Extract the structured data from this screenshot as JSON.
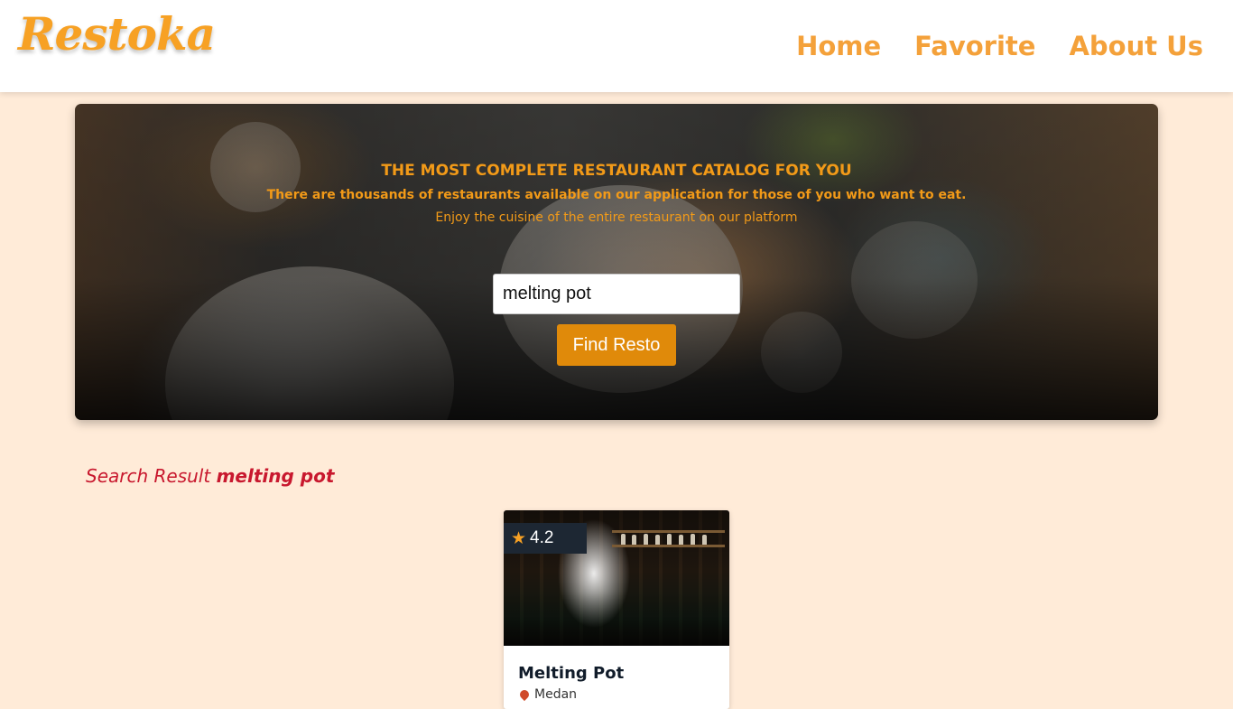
{
  "header": {
    "logo": "Restoka",
    "nav": [
      "Home",
      "Favorite",
      "About Us"
    ]
  },
  "hero": {
    "title": "THE MOST COMPLETE RESTAURANT CATALOG FOR YOU",
    "subtitle": "There are thousands of restaurants available on our application for those of you who want to eat.",
    "tagline": "Enjoy the cuisine of the entire restaurant on our platform"
  },
  "search": {
    "value": "melting pot",
    "button_label": "Find Resto"
  },
  "result": {
    "prefix": "Search Result",
    "query": "melting pot"
  },
  "restaurants": [
    {
      "name": "Melting Pot",
      "rating": "4.2",
      "city": "Medan"
    }
  ],
  "colors": {
    "background": "#ffebd8",
    "accent": "#f4a13a",
    "button": "#e08a0a",
    "result_text": "#c8182e"
  }
}
